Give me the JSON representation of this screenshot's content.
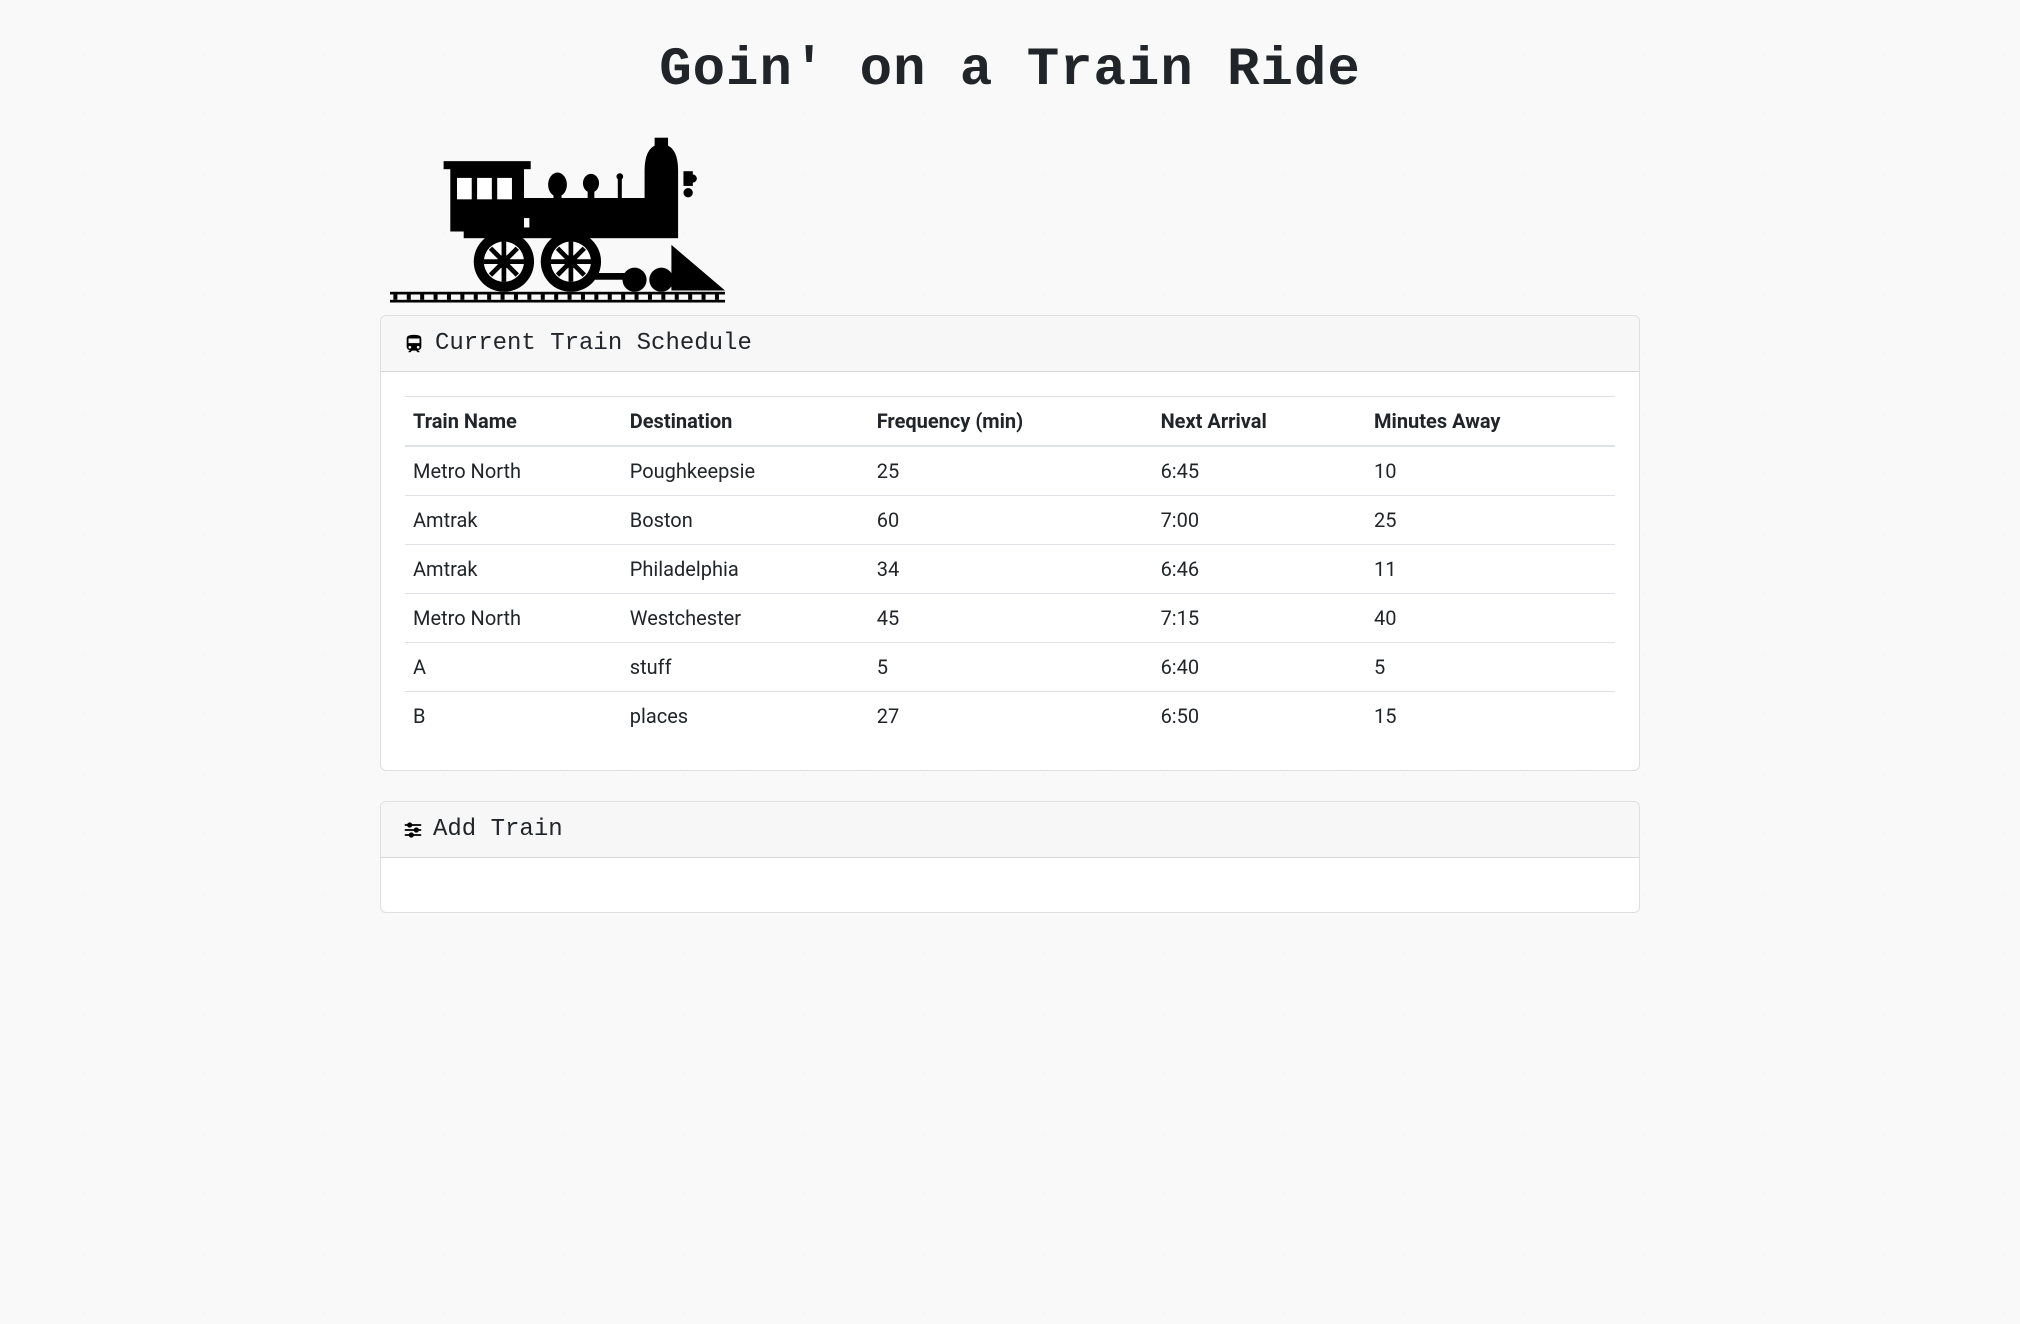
{
  "page_title": "Goin' on a Train Ride",
  "schedule_panel": {
    "header": "Current Train Schedule",
    "columns": [
      "Train Name",
      "Destination",
      "Frequency (min)",
      "Next Arrival",
      "Minutes Away"
    ],
    "rows": [
      {
        "name": "Metro North",
        "dest": "Poughkeepsie",
        "freq": "25",
        "next": "6:45",
        "away": "10"
      },
      {
        "name": "Amtrak",
        "dest": "Boston",
        "freq": "60",
        "next": "7:00",
        "away": "25"
      },
      {
        "name": "Amtrak",
        "dest": "Philadelphia",
        "freq": "34",
        "next": "6:46",
        "away": "11"
      },
      {
        "name": "Metro North",
        "dest": "Westchester",
        "freq": "45",
        "next": "7:15",
        "away": "40"
      },
      {
        "name": "A",
        "dest": "stuff",
        "freq": "5",
        "next": "6:40",
        "away": "5"
      },
      {
        "name": "B",
        "dest": "places",
        "freq": "27",
        "next": "6:50",
        "away": "15"
      }
    ]
  },
  "add_panel": {
    "header": "Add Train"
  }
}
